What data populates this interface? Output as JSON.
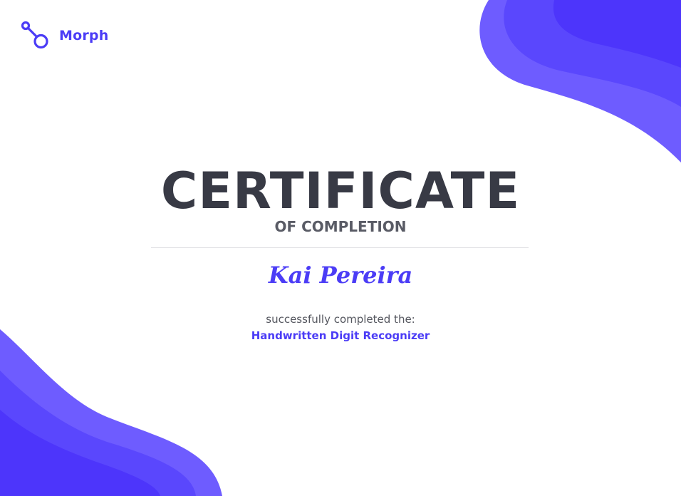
{
  "brand": {
    "name": "Morph",
    "icon": "morph-logo-icon"
  },
  "certificate": {
    "title": "CERTIFICATE",
    "subtitle": "OF COMPLETION",
    "recipient": "Kai Pereira",
    "intro": "successfully completed the:",
    "course": "Handwritten Digit Recognizer"
  },
  "colors": {
    "accent": "#4b3cf6",
    "title": "#383a45",
    "subtitle": "#595b65",
    "body_text": "#55575f",
    "wave_dark": "#4d35fb",
    "wave_mid": "#5a47fd",
    "wave_light": "#6e5cff",
    "rule": "#e3e3e6"
  }
}
